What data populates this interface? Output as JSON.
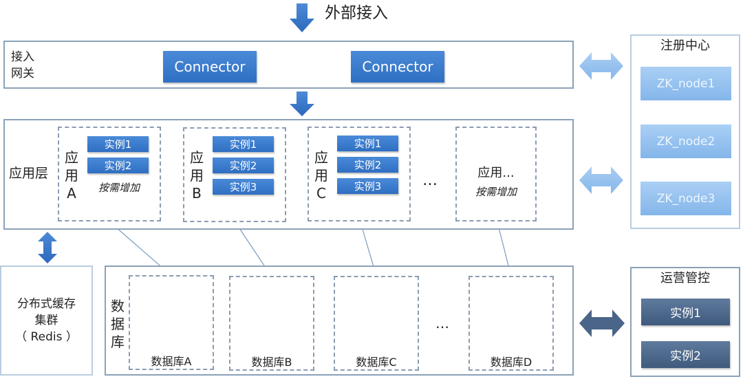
{
  "top_label": "外部接入",
  "gateway": {
    "label_line1": "接入",
    "label_line2": "网关",
    "connectors": [
      "Connector",
      "Connector"
    ]
  },
  "registry": {
    "title": "注册中心",
    "nodes": [
      "ZK_node1",
      "ZK_node2",
      "ZK_node3"
    ]
  },
  "app_layer": {
    "label": "应用层",
    "apps": [
      {
        "name_lines": [
          "应",
          "用",
          "A"
        ],
        "instances": [
          "实例1",
          "实例2"
        ],
        "note": "按需增加"
      },
      {
        "name_lines": [
          "应",
          "用",
          "B"
        ],
        "instances": [
          "实例1",
          "实例2",
          "实例3"
        ]
      },
      {
        "name_lines": [
          "应",
          "用",
          "C"
        ],
        "instances": [
          "实例1",
          "实例2",
          "实例3"
        ]
      }
    ],
    "ellipsis": "…",
    "more_app": {
      "label": "应用...",
      "note": "按需增加"
    }
  },
  "cache": {
    "line1": "分布式缓存",
    "line2": "集群",
    "line3": "（ Redis ）"
  },
  "database": {
    "label_lines": [
      "数",
      "据",
      "库"
    ],
    "dbs": [
      "数据库A",
      "数据库B",
      "数据库C",
      "数据库D"
    ],
    "ellipsis": "…"
  },
  "ops": {
    "title": "运营管控",
    "instances": [
      "实例1",
      "实例2"
    ]
  },
  "colors": {
    "primary_blue": "#2f6fc2",
    "light_blue": "#8fbdee",
    "ops_navy": "#4a6587",
    "panel_border": "#8aa1b8"
  }
}
